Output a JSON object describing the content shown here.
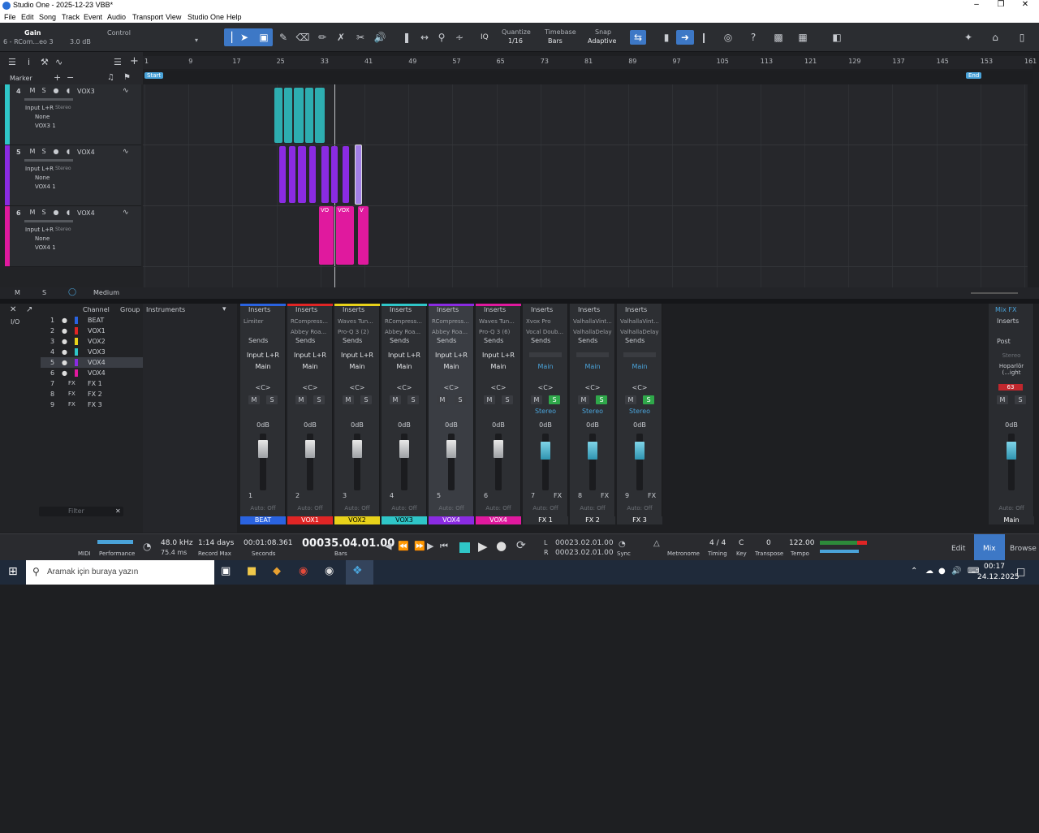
{
  "window": {
    "title": "Studio One - 2025-12-23 VBB*"
  },
  "menu": [
    "File",
    "Edit",
    "Song",
    "Track",
    "Event",
    "Audio",
    "Transport",
    "View",
    "Studio One",
    "Help"
  ],
  "toolbar": {
    "gain_label": "Gain",
    "gain_track": "6 - RCom...eo 3",
    "gain_value": "3.0 dB",
    "control_label": "Control",
    "quantize_label": "Quantize",
    "quantize_value": "1/16",
    "timebase_label": "Timebase",
    "timebase_value": "Bars",
    "snap_label": "Snap",
    "snap_value": "Adaptive",
    "iq": "IQ"
  },
  "ruler": {
    "bars": [
      "1",
      "9",
      "17",
      "25",
      "33",
      "41",
      "49",
      "57",
      "65",
      "73",
      "81",
      "89",
      "97",
      "105",
      "113",
      "121",
      "129",
      "137",
      "145",
      "153",
      "161"
    ],
    "start_marker": "Start",
    "end_marker": "End"
  },
  "left_panel": {
    "marker_label": "Marker",
    "zoom_label": "Medium",
    "bottom_m": "M",
    "bottom_s": "S"
  },
  "tracks": [
    {
      "num": "4",
      "name": "VOX3",
      "input": "Input L+R",
      "stereo": "Stereo",
      "none": "None",
      "out": "VOX3 1",
      "color": "#2fc6c8"
    },
    {
      "num": "5",
      "name": "VOX4",
      "input": "Input L+R",
      "stereo": "Stereo",
      "none": "None",
      "out": "VOX4 1",
      "color": "#8a2be2"
    },
    {
      "num": "6",
      "name": "VOX4",
      "input": "Input L+R",
      "stereo": "Stereo",
      "none": "None",
      "out": "VOX4 1",
      "color": "#e0199e"
    }
  ],
  "clip_labels": {
    "vox_a": "VO",
    "vox_b": "VOX",
    "vox_c": "V"
  },
  "channel_list": {
    "header_channel": "Channel",
    "header_group": "Group",
    "io": "I/O",
    "filter_placeholder": "Filter",
    "channels": [
      {
        "num": "1",
        "name": "BEAT",
        "color": "#2a63e0"
      },
      {
        "num": "2",
        "name": "VOX1",
        "color": "#e02525"
      },
      {
        "num": "3",
        "name": "VOX2",
        "color": "#e8d21a"
      },
      {
        "num": "4",
        "name": "VOX3",
        "color": "#2fc6c8"
      },
      {
        "num": "5",
        "name": "VOX4",
        "color": "#8a2be2"
      },
      {
        "num": "6",
        "name": "VOX4",
        "color": "#e0199e"
      },
      {
        "num": "7",
        "name": "FX 1",
        "color": ""
      },
      {
        "num": "8",
        "name": "FX 2",
        "color": ""
      },
      {
        "num": "9",
        "name": "FX 3",
        "color": ""
      }
    ],
    "fx_tag": "FX"
  },
  "instruments": {
    "title": "Instruments"
  },
  "mixer": {
    "inserts": "Inserts",
    "sends": "Sends",
    "auto_off": "Auto: Off",
    "zero_db": "0dB",
    "pan": "<C>",
    "strips": [
      {
        "num": "1",
        "name": "BEAT",
        "color": "#2a63e0",
        "insert1": "Limiter",
        "insert2": "",
        "input": "Input L+R",
        "out": "Main"
      },
      {
        "num": "2",
        "name": "VOX1",
        "color": "#e02525",
        "insert1": "RCompress...",
        "insert2": "Abbey Roa...",
        "input": "Input L+R",
        "out": "Main"
      },
      {
        "num": "3",
        "name": "VOX2",
        "color": "#e8d21a",
        "insert1": "Waves Tun...",
        "insert2": "Pro-Q 3 (2)",
        "input": "Input L+R",
        "out": "Main"
      },
      {
        "num": "4",
        "name": "VOX3",
        "color": "#2fc6c8",
        "insert1": "RCompress...",
        "insert2": "Abbey Roa...",
        "input": "Input L+R",
        "out": "Main"
      },
      {
        "num": "5",
        "name": "VOX4",
        "color": "#8a2be2",
        "insert1": "RCompress...",
        "insert2": "Abbey Roa...",
        "input": "Input L+R",
        "out": "Main"
      },
      {
        "num": "6",
        "name": "VOX4",
        "color": "#e0199e",
        "insert1": "Waves Tun...",
        "insert2": "Pro-Q 3 (6)",
        "input": "Input L+R",
        "out": "Main"
      }
    ],
    "fx_strips": [
      {
        "num": "7",
        "name": "FX 1",
        "insert1": "Xvox Pro",
        "insert2": "Vocal Doub...",
        "out": "Main",
        "stereo": "Stereo",
        "fx": "FX"
      },
      {
        "num": "8",
        "name": "FX 2",
        "insert1": "ValhallaVint...",
        "insert2": "ValhallaDelay",
        "out": "Main",
        "stereo": "Stereo",
        "fx": "FX"
      },
      {
        "num": "9",
        "name": "FX 3",
        "insert1": "ValhallaVint...",
        "insert2": "ValhallaDelay",
        "out": "Main",
        "stereo": "Stereo",
        "fx": "FX"
      }
    ],
    "main": {
      "mix_fx": "Mix FX",
      "post": "Post",
      "stereo": "Stereo",
      "output": "Hoparlör (...ight",
      "level": "63",
      "name": "Main"
    },
    "ms": {
      "m": "M",
      "s": "S"
    }
  },
  "transport": {
    "midi": "MIDI",
    "performance": "Performance",
    "sample_rate": "48.0 kHz",
    "latency": "75.4 ms",
    "record_days": "1:14 days",
    "record_max": "Record Max",
    "time_seconds": "00:01:08.361",
    "seconds_label": "Seconds",
    "bars_pos": "00035.04.01.00",
    "bars_label": "Bars",
    "loop_l": "00023.02.01.00",
    "loop_r": "00023.02.01.00",
    "l_label": "L",
    "r_label": "R",
    "sync": "Sync",
    "metronome": "Metronome",
    "timing_value": "4 / 4",
    "timing_label": "Timing",
    "key_value": "C",
    "key_label": "Key",
    "transpose_value": "0",
    "transpose_label": "Transpose",
    "tempo_value": "122.00",
    "tempo_label": "Tempo",
    "edit": "Edit",
    "mix": "Mix",
    "browse": "Browse"
  },
  "taskbar": {
    "search_placeholder": "Aramak için buraya yazın",
    "time": "00:17",
    "date": "24.12.2025"
  }
}
